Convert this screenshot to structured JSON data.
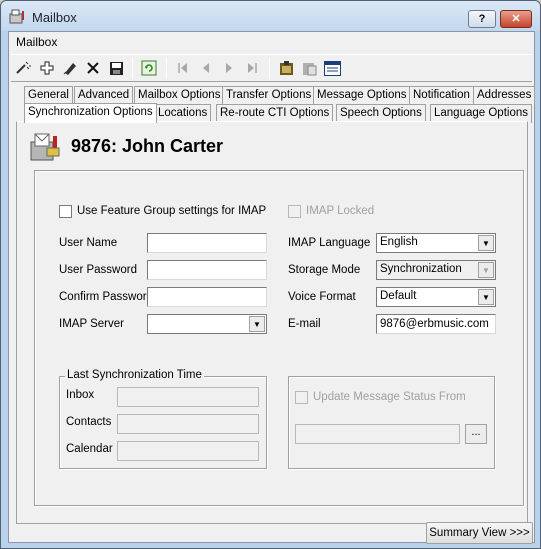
{
  "window": {
    "title": "Mailbox"
  },
  "menu": {
    "mailbox": "Mailbox"
  },
  "toolbar": {
    "icons": [
      "wand-icon",
      "add-icon",
      "edit-icon",
      "delete-icon",
      "save-icon",
      "refresh-icon",
      "first-record-icon",
      "previous-record-icon",
      "next-record-icon",
      "last-record-icon",
      "clipboard-icon",
      "paste-icon",
      "form-view-icon"
    ]
  },
  "tabs": {
    "row1": [
      "General",
      "Advanced",
      "Mailbox Options",
      "Transfer Options",
      "Message Options",
      "Notification",
      "Addresses"
    ],
    "row2": [
      "Synchronization Options",
      "Locations",
      "Re-route CTI Options",
      "Speech Options",
      "Language Options"
    ],
    "active": "Synchronization Options"
  },
  "header": {
    "title": "9876: John Carter"
  },
  "form": {
    "use_feature_group": "Use Feature Group settings for IMAP",
    "imap_locked": "IMAP Locked",
    "user_name_label": "User Name",
    "user_name_value": "",
    "user_password_label": "User Password",
    "user_password_value": "",
    "confirm_password_label": "Confirm Password",
    "confirm_password_value": "",
    "imap_server_label": "IMAP Server",
    "imap_server_value": "",
    "imap_language_label": "IMAP Language",
    "imap_language_value": "English",
    "storage_mode_label": "Storage Mode",
    "storage_mode_value": "Synchronization",
    "voice_format_label": "Voice Format",
    "voice_format_value": "Default",
    "email_label": "E-mail",
    "email_value": "9876@erbmusic.com"
  },
  "last_sync": {
    "title": "Last Synchronization Time",
    "inbox_label": "Inbox",
    "contacts_label": "Contacts",
    "calendar_label": "Calendar"
  },
  "update_status": {
    "label": "Update Message Status From",
    "browse_label": "..."
  },
  "footer": {
    "summary_view": "Summary View >>>"
  }
}
